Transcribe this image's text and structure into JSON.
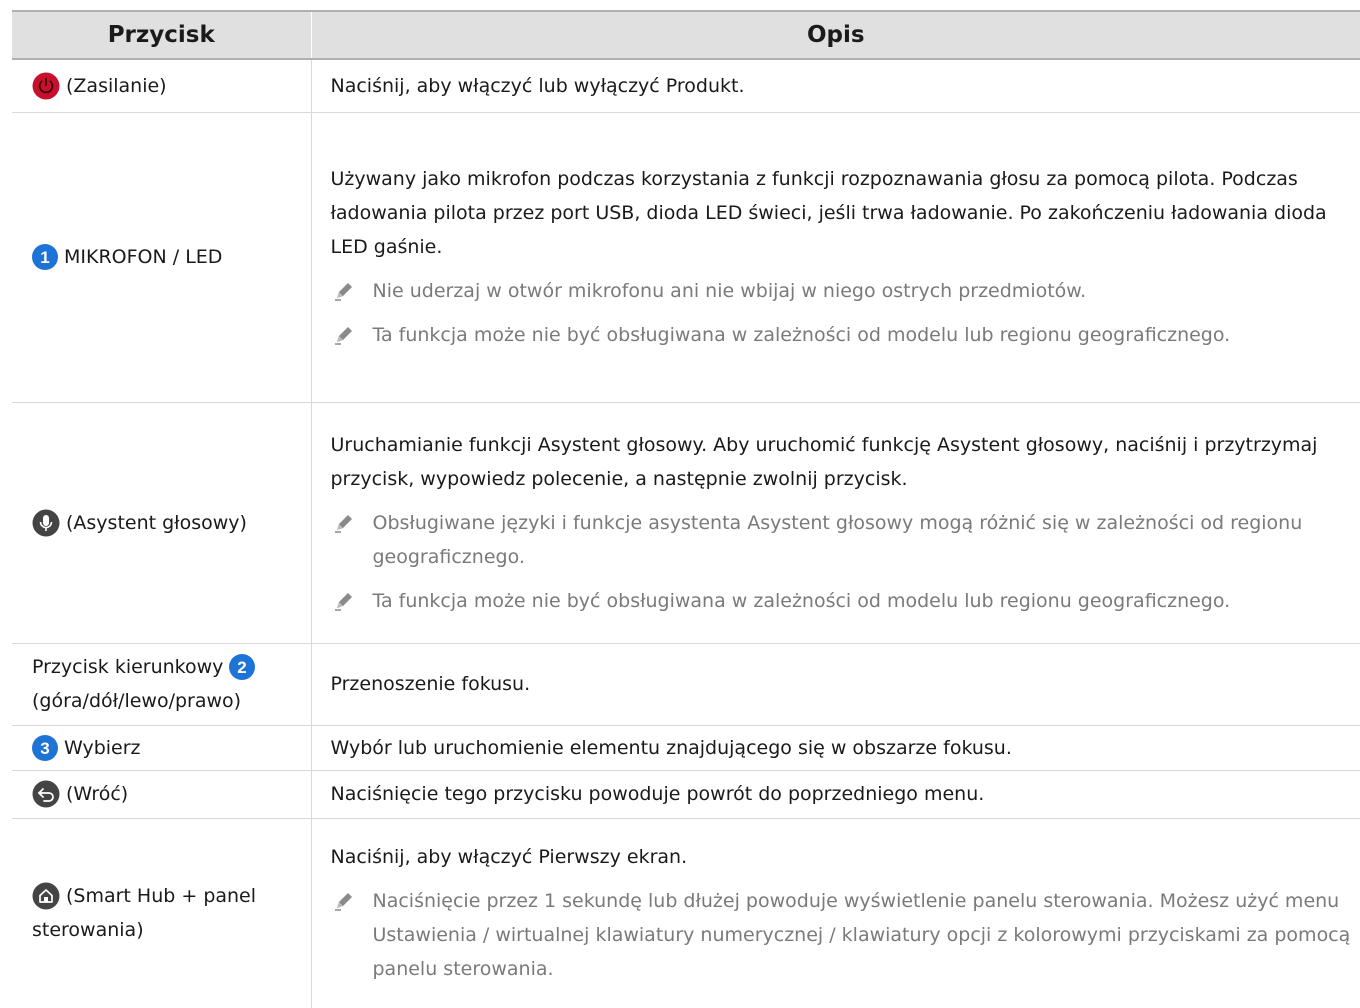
{
  "table": {
    "header": {
      "col1": "Przycisk",
      "col2": "Opis"
    },
    "rows": [
      {
        "button": "(Zasilanie)",
        "icon": "power-icon",
        "desc": "Naciśnij, aby włączyć lub wyłączyć Produkt."
      },
      {
        "button": "MIKROFON / LED",
        "icon": "number-1-badge",
        "desc": "Używany jako mikrofon podczas korzystania z funkcji rozpoznawania głosu za pomocą pilota. Podczas ładowania pilota przez port USB, dioda LED świeci, jeśli trwa ładowanie. Po zakończeniu ładowania dioda LED gaśnie.",
        "notes": [
          "Nie uderzaj w otwór mikrofonu ani nie wbijaj w niego ostrych przedmiotów.",
          "Ta funkcja może nie być obsługiwana w zależności od modelu lub regionu geograficznego."
        ]
      },
      {
        "button": "(Asystent głosowy)",
        "icon": "microphone-icon",
        "desc": "Uruchamianie funkcji Asystent głosowy. Aby uruchomić funkcję Asystent głosowy, naciśnij i przytrzymaj przycisk, wypowiedz polecenie, a następnie zwolnij przycisk.",
        "notes": [
          "Obsługiwane języki i funkcje asystenta Asystent głosowy mogą różnić się w zależności od regionu geograficznego.",
          "Ta funkcja może nie być obsługiwana w zależności od modelu lub regionu geograficznego."
        ]
      },
      {
        "button_line1": "Przycisk kierunkowy",
        "button_line2": "(góra/dół/lewo/prawo)",
        "icon": "number-2-badge",
        "desc": "Przenoszenie fokusu."
      },
      {
        "button": "Wybierz",
        "icon": "number-3-badge",
        "desc": "Wybór lub uruchomienie elementu znajdującego się w obszarze fokusu."
      },
      {
        "button": "(Wróć)",
        "icon": "back-arrow-icon",
        "desc": "Naciśnięcie tego przycisku powoduje powrót do poprzedniego menu."
      },
      {
        "button_line1": "(Smart Hub + panel",
        "button_line2": "sterowania)",
        "icon": "home-icon",
        "desc": "Naciśnij, aby włączyć Pierwszy ekran.",
        "notes": [
          "Naciśnięcie przez 1 sekundę lub dłużej powoduje wyświetlenie panelu sterowania. Możesz użyć menu Ustawienia / wirtualnej klawiatury numerycznej / klawiatury opcji z kolorowymi przyciskami za pomocą panelu sterowania."
        ]
      }
    ]
  },
  "colors": {
    "power": "#c8102e",
    "badge": "#1e73d6",
    "icon_dark": "#444444",
    "note_text": "#7a7a7a",
    "header_bg": "#e0e0e0"
  },
  "badges": {
    "b1": "1",
    "b2": "2",
    "b3": "3"
  }
}
